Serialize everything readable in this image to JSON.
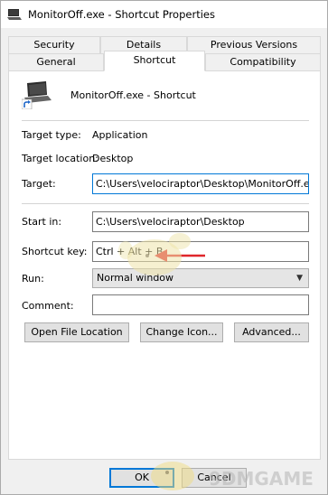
{
  "window": {
    "title": "MonitorOff.exe - Shortcut Properties"
  },
  "tabs": {
    "row1": [
      {
        "label": "Security"
      },
      {
        "label": "Details"
      },
      {
        "label": "Previous Versions"
      }
    ],
    "row2": [
      {
        "label": "General"
      },
      {
        "label": "Shortcut",
        "active": true
      },
      {
        "label": "Compatibility"
      }
    ]
  },
  "shortcut": {
    "name": "MonitorOff.exe - Shortcut",
    "target_type_label": "Target type:",
    "target_type_value": "Application",
    "target_location_label": "Target location:",
    "target_location_value": "Desktop",
    "target_label": "Target:",
    "target_value": "C:\\Users\\velociraptor\\Desktop\\MonitorOff.exe",
    "start_in_label": "Start in:",
    "start_in_value": "C:\\Users\\velociraptor\\Desktop",
    "shortcut_key_label": "Shortcut key:",
    "shortcut_key_value": "Ctrl + Alt + B",
    "run_label": "Run:",
    "run_value": "Normal window",
    "comment_label": "Comment:",
    "comment_value": ""
  },
  "buttons": {
    "open_file_location": "Open File Location",
    "change_icon": "Change Icon...",
    "advanced": "Advanced...",
    "ok": "OK",
    "cancel": "Cancel"
  },
  "watermark": {
    "text": "9DMGAME"
  },
  "colors": {
    "focus_border": "#0078d7",
    "annotation_arrow": "#e0262b",
    "panel_bg": "#ffffff",
    "window_bg": "#f0f0f0"
  }
}
